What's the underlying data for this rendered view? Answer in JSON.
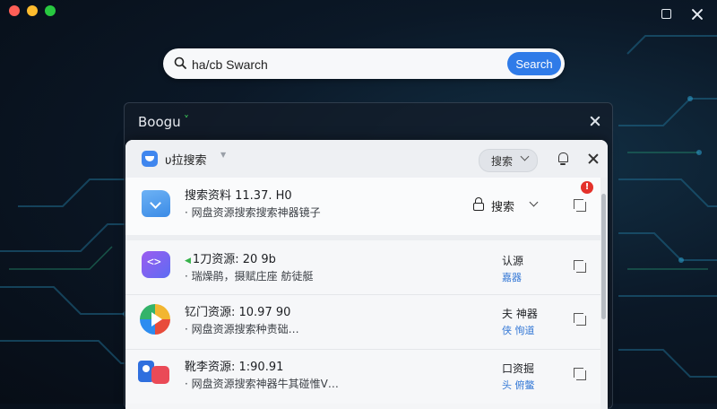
{
  "window": {
    "controls": [
      "close",
      "minimize",
      "maximize"
    ]
  },
  "search": {
    "value": "ha/cb Swarch",
    "button_label": "Search"
  },
  "dark_panel": {
    "title": "Boogu",
    "chevron": "˅"
  },
  "panel": {
    "title": "υ拉搜索",
    "caret": "▼",
    "filter_label": "搜索"
  },
  "results": [
    {
      "icon": "folder-icon",
      "badge": "",
      "title": "搜索资料 11.37. H0",
      "subtitle": "· 网盘资源搜索搜索神器镜子",
      "action_label": "搜索",
      "notification_count": "!"
    },
    {
      "icon": "code-link-icon",
      "badge": "◀",
      "title": "1刀资源: 20 9b",
      "subtitle": "· 瑞燥鹃，摄赋庄座  舫徒艇",
      "tag": "认源",
      "tag2": "嘉器"
    },
    {
      "icon": "play-icon",
      "badge": "",
      "title": "钇门资源: 10.97 90",
      "subtitle": "· 网盘资源搜索种责础…",
      "tag": "夫 神器",
      "tag2": "侠 恂道"
    },
    {
      "icon": "id-card-icon",
      "badge": "",
      "title": "靴李资源: 1:90.91",
      "subtitle": "· 网盘资源搜索神器牛其碰惟V…",
      "tag": "口资掘",
      "tag2": "头 俯鳖"
    }
  ],
  "colors": {
    "accent": "#2f7be8",
    "badge_red": "#e4322b",
    "link_blue": "#3579d6",
    "green": "#36b24a"
  }
}
